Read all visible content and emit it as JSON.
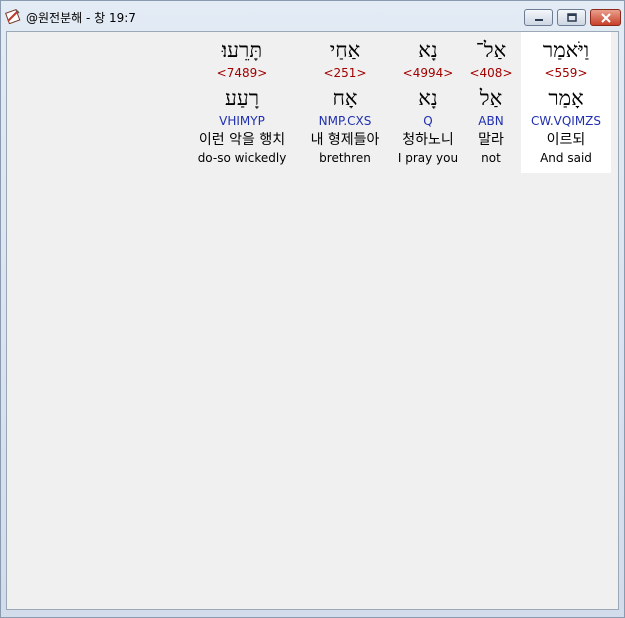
{
  "window": {
    "title": "@원전분해 - 창 19:7",
    "icon": "pen-document-icon"
  },
  "words": [
    {
      "hebrew": "וַיֹּאמַר",
      "strong": "<559>",
      "root": "אָמַר",
      "parse": "CW.VQIMZS",
      "korean": "이르되",
      "english": "And said",
      "selected": true
    },
    {
      "hebrew": "אַל־",
      "strong": "<408>",
      "root": "אַל",
      "parse": "ABN",
      "korean": "말라",
      "english": "not",
      "selected": false
    },
    {
      "hebrew": "נָא",
      "strong": "<4994>",
      "root": "נָא",
      "parse": "Q",
      "korean": "청하노니",
      "english": "I pray you",
      "selected": false
    },
    {
      "hebrew": "אַחַי",
      "strong": "<251>",
      "root": "אָח",
      "parse": "NMP.CXS",
      "korean": "내 형제들아",
      "english": "brethren",
      "selected": false
    },
    {
      "hebrew": "תָּרֵעוּ׃",
      "strong": "<7489>",
      "root": "רָעַע",
      "parse": "VHIMYP",
      "korean": "이런 악을 행치",
      "english": "do-so wickedly",
      "selected": false
    }
  ],
  "colors": {
    "strong": "#a00000",
    "parse": "#1f2fb0",
    "client_bg": "#f0f0f0",
    "selected_bg": "#ffffff",
    "close_button": "#c8402a"
  }
}
